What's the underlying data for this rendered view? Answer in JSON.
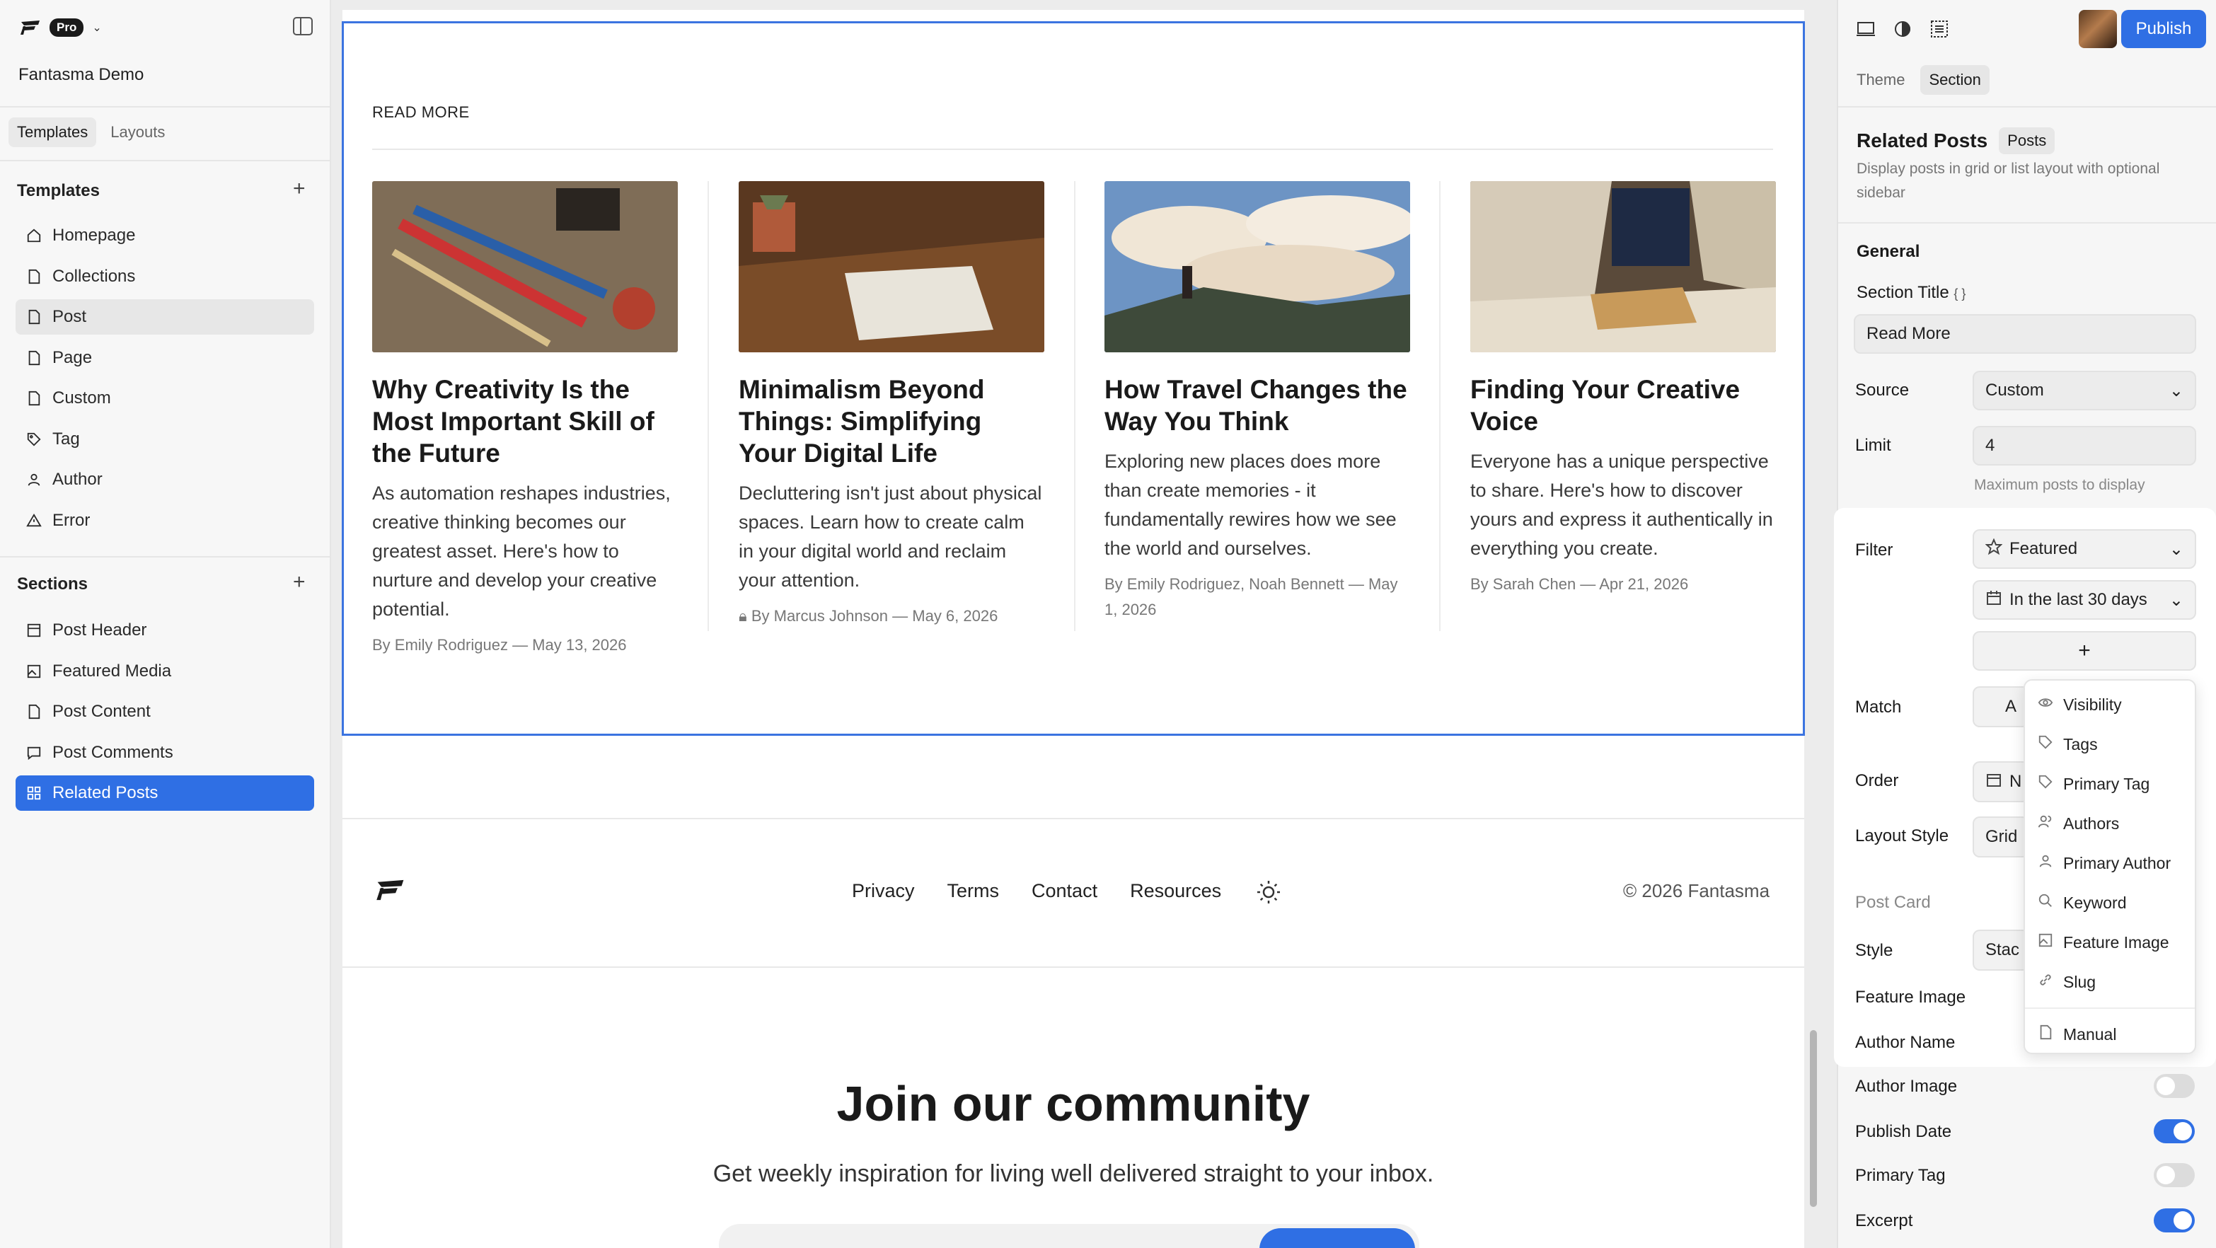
{
  "app": {
    "badge": "Pro",
    "site_name": "Fantasma Demo"
  },
  "sidebar": {
    "tabs": [
      {
        "label": "Templates"
      },
      {
        "label": "Layouts"
      }
    ],
    "templates_heading": "Templates",
    "templates": [
      {
        "label": "Homepage",
        "icon": "home-icon"
      },
      {
        "label": "Collections",
        "icon": "file-icon"
      },
      {
        "label": "Post",
        "icon": "file-icon"
      },
      {
        "label": "Page",
        "icon": "file-icon"
      },
      {
        "label": "Custom",
        "icon": "file-icon"
      },
      {
        "label": "Tag",
        "icon": "tag-icon"
      },
      {
        "label": "Author",
        "icon": "user-icon"
      },
      {
        "label": "Error",
        "icon": "warning-icon"
      }
    ],
    "sections_heading": "Sections",
    "sections": [
      {
        "label": "Post Header",
        "icon": "layout-icon"
      },
      {
        "label": "Featured Media",
        "icon": "image-icon"
      },
      {
        "label": "Post Content",
        "icon": "file-icon"
      },
      {
        "label": "Post Comments",
        "icon": "comment-icon"
      },
      {
        "label": "Related Posts",
        "icon": "grid-icon"
      }
    ]
  },
  "canvas": {
    "section_title": "READ MORE",
    "cards": [
      {
        "title": "Why Creativity Is the Most Important Skill of the Future",
        "excerpt": "As automation reshapes industries, creative thinking becomes our greatest asset. Here's how to nurture and develop your creative potential.",
        "meta": "By Emily Rodriguez — May 13, 2026"
      },
      {
        "title": "Minimalism Beyond Things: Simplifying Your Digital Life",
        "excerpt": "Decluttering isn't just about physical spaces. Learn how to create calm in your digital world and reclaim your attention.",
        "meta": "By Marcus Johnson — May 6, 2026"
      },
      {
        "title": "How Travel Changes the Way You Think",
        "excerpt": "Exploring new places does more than create memories - it fundamentally rewires how we see the world and ourselves.",
        "meta": "By Emily Rodriguez, Noah Bennett — May 1, 2026"
      },
      {
        "title": "Finding Your Creative Voice",
        "excerpt": "Everyone has a unique perspective to share. Here's how to discover yours and express it authentically in everything you create.",
        "meta": "By Sarah Chen — Apr 21, 2026"
      }
    ],
    "footer": {
      "links": [
        "Privacy",
        "Terms",
        "Contact",
        "Resources"
      ],
      "copyright": "© 2026 Fantasma"
    },
    "newsletter": {
      "heading": "Join our community",
      "subtitle": "Get weekly inspiration for living well delivered straight to your inbox."
    }
  },
  "panel": {
    "publish_label": "Publish",
    "tabs": [
      {
        "label": "Theme"
      },
      {
        "label": "Section"
      }
    ],
    "title": "Related Posts",
    "badge": "Posts",
    "description": "Display posts in grid or list layout with optional sidebar",
    "general_heading": "General",
    "section_title_label": "Section Title",
    "section_title_value": "Read More",
    "source_label": "Source",
    "source_value": "Custom",
    "limit_label": "Limit",
    "limit_value": "4",
    "limit_hint": "Maximum posts to display",
    "filter_label": "Filter",
    "filter_value": "Featured",
    "date_value": "In the last 30 days",
    "add_symbol": "+",
    "match_label": "Match",
    "match_value": "A",
    "order_label": "Order",
    "order_value": "N",
    "layout_style_label": "Layout Style",
    "layout_style_value": "Grid",
    "post_card_heading": "Post Card",
    "style_label": "Style",
    "style_value": "Stac",
    "toggles": [
      {
        "label": "Feature Image",
        "on": true
      },
      {
        "label": "Author Name",
        "on": true
      },
      {
        "label": "Author Image",
        "on": false
      },
      {
        "label": "Publish Date",
        "on": true
      },
      {
        "label": "Primary Tag",
        "on": false
      },
      {
        "label": "Excerpt",
        "on": true
      }
    ]
  },
  "filter_menu": {
    "items": [
      {
        "label": "Visibility",
        "icon": "eye-icon"
      },
      {
        "label": "Tags",
        "icon": "tag-icon"
      },
      {
        "label": "Primary Tag",
        "icon": "tag-icon"
      },
      {
        "label": "Authors",
        "icon": "users-icon"
      },
      {
        "label": "Primary Author",
        "icon": "user-icon"
      },
      {
        "label": "Keyword",
        "icon": "search-icon"
      },
      {
        "label": "Feature Image",
        "icon": "image-icon"
      },
      {
        "label": "Slug",
        "icon": "link-icon"
      }
    ],
    "extra_item": {
      "label": "Manual",
      "icon": "file-icon"
    }
  },
  "colors": {
    "accent": "#2f6fe4",
    "selection": "#3b74e0"
  }
}
